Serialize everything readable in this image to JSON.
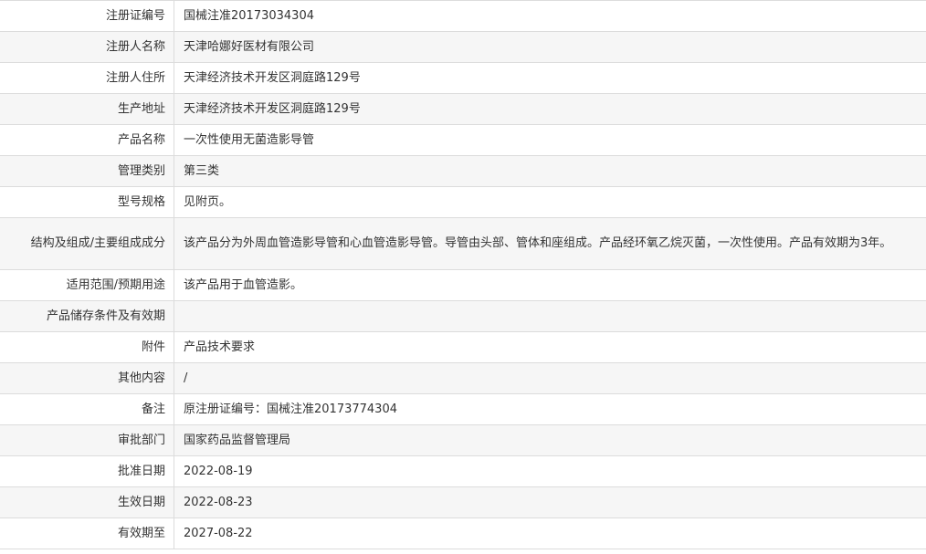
{
  "rows": [
    {
      "label": "注册证编号",
      "value": "国械注准20173034304"
    },
    {
      "label": "注册人名称",
      "value": "天津哈娜好医材有限公司"
    },
    {
      "label": "注册人住所",
      "value": "天津经济技术开发区洞庭路129号"
    },
    {
      "label": "生产地址",
      "value": "天津经济技术开发区洞庭路129号"
    },
    {
      "label": "产品名称",
      "value": "一次性使用无菌造影导管"
    },
    {
      "label": "管理类别",
      "value": "第三类"
    },
    {
      "label": "型号规格",
      "value": "见附页。"
    },
    {
      "label": "结构及组成/主要组成成分",
      "value": "该产品分为外周血管造影导管和心血管造影导管。导管由头部、管体和座组成。产品经环氧乙烷灭菌，一次性使用。产品有效期为3年。"
    },
    {
      "label": "适用范围/预期用途",
      "value": "该产品用于血管造影。"
    },
    {
      "label": "产品储存条件及有效期",
      "value": ""
    },
    {
      "label": "附件",
      "value": "产品技术要求"
    },
    {
      "label": "其他内容",
      "value": "/"
    },
    {
      "label": "备注",
      "value": "原注册证编号：国械注准20173774304"
    },
    {
      "label": "审批部门",
      "value": "国家药品监督管理局"
    },
    {
      "label": "批准日期",
      "value": "2022-08-19"
    },
    {
      "label": "生效日期",
      "value": "2022-08-23"
    },
    {
      "label": "有效期至",
      "value": "2027-08-22"
    }
  ]
}
